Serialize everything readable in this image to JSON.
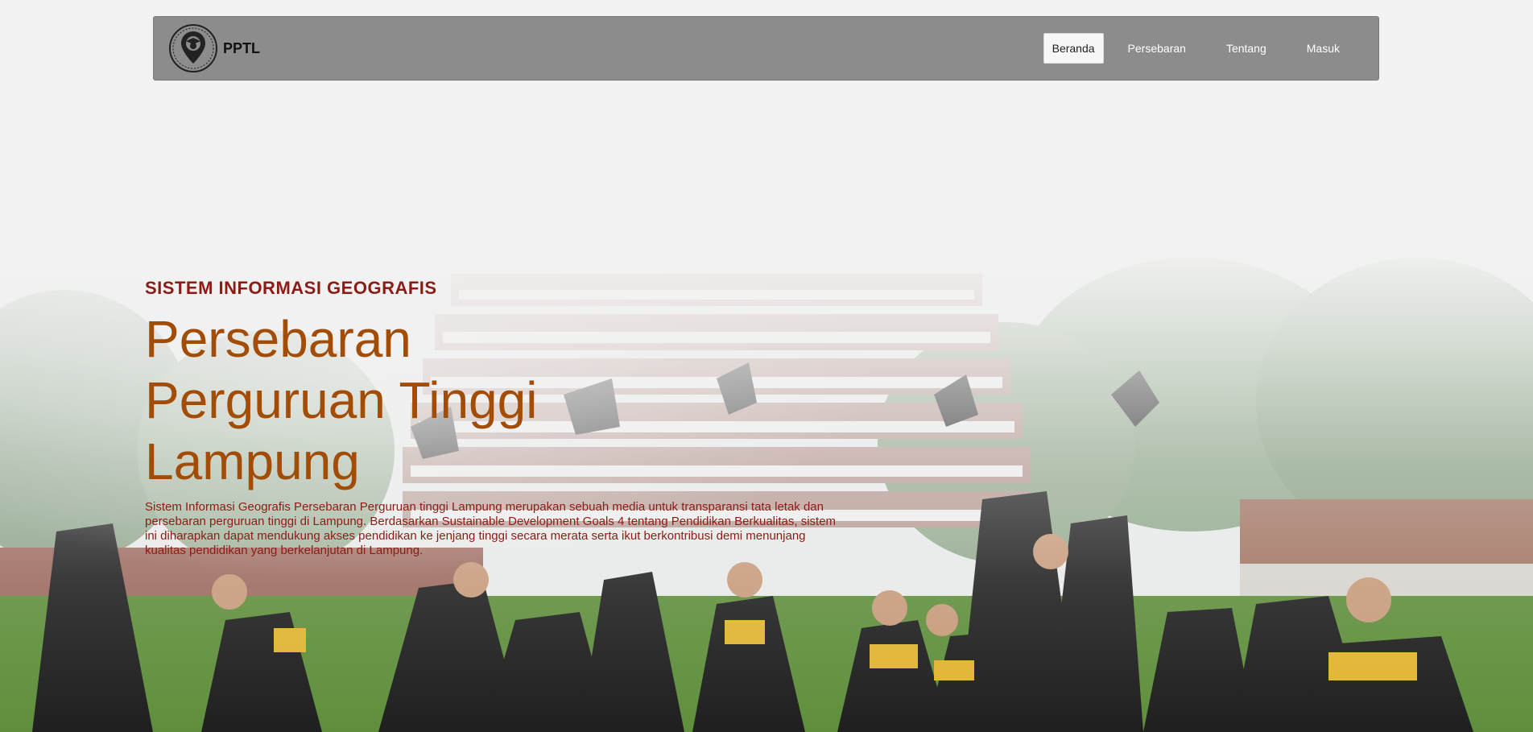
{
  "brand": {
    "name": "PPTL",
    "logo_icon": "map-pin-graduate-logo"
  },
  "nav": {
    "items": [
      {
        "label": "Beranda",
        "active": true
      },
      {
        "label": "Persebaran",
        "active": false
      },
      {
        "label": "Tentang",
        "active": false
      },
      {
        "label": "Masuk",
        "active": false
      }
    ]
  },
  "hero": {
    "kicker": "SISTEM INFORMASI GEOGRAFIS",
    "title": "Persebaran Perguruan Tinggi Lampung",
    "description": "Sistem Informasi Geografis Persebaran Perguruan tinggi Lampung merupakan sebuah media untuk transparansi tata letak dan persebaran perguruan tinggi di Lampung. Berdasarkan Sustainable Development Goals 4 tentang Pendidikan Berkualitas, sistem ini diharapkan dapat mendukung akses pendidikan ke jenjang tinggi secara merata serta ikut berkontribusi demi menunjang kualitas pendidikan yang berkelanjutan di Lampung."
  },
  "colors": {
    "navbar_bg": "#8c8c8c",
    "kicker": "#8b1c14",
    "title": "#a24c05",
    "description": "#8b1c14"
  }
}
